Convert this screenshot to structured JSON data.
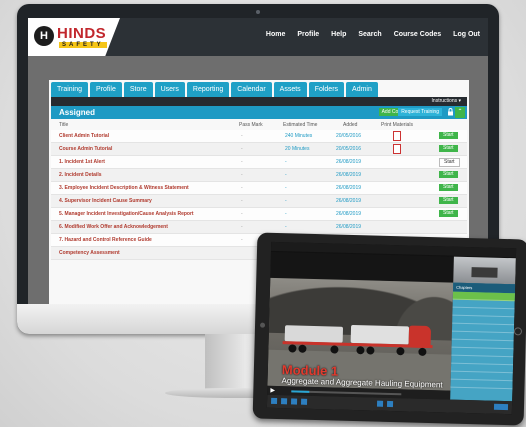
{
  "app": {
    "logo_main": "HINDS",
    "logo_sub": "SAFETY",
    "logo_mark": "H"
  },
  "topnav": [
    "Home",
    "Profile",
    "Help",
    "Search",
    "Course Codes",
    "Log Out"
  ],
  "tabs": [
    "Training",
    "Profile",
    "Store",
    "Users",
    "Reporting",
    "Calendar",
    "Assets",
    "Folders",
    "Admin"
  ],
  "toolbar": {
    "instructions": "Instructions ▾"
  },
  "assigned": {
    "title": "Assigned",
    "add_course": "Add Course",
    "request_training": "Request Training",
    "lock_icon": "lock-icon",
    "collapse_icon": "chevron-up-icon"
  },
  "columns": [
    "Title",
    "Pass Mark",
    "Estimated Time",
    "Added",
    "Print Materials"
  ],
  "rows": [
    {
      "title": "Client Admin Tutorial",
      "pass": "-",
      "est": "240 Minutes",
      "added": "20/05/2016",
      "pdf": true,
      "action": "Start",
      "style": "green"
    },
    {
      "title": "Course Admin Tutorial",
      "pass": "-",
      "est": "20 Minutes",
      "added": "20/05/2016",
      "pdf": true,
      "action": "Start",
      "style": "green"
    },
    {
      "title": "1. Incident 1st Alert",
      "pass": "-",
      "est": "-",
      "added": "26/08/2019",
      "pdf": false,
      "action": "Start",
      "style": "white"
    },
    {
      "title": "2. Incident Details",
      "pass": "-",
      "est": "-",
      "added": "26/08/2019",
      "pdf": false,
      "action": "Start",
      "style": "green"
    },
    {
      "title": "3. Employee Incident Description & Witness Statement",
      "pass": "-",
      "est": "-",
      "added": "26/08/2019",
      "pdf": false,
      "action": "Start",
      "style": "green"
    },
    {
      "title": "4. Supervisor Incident Cause Summary",
      "pass": "-",
      "est": "-",
      "added": "26/08/2019",
      "pdf": false,
      "action": "Start",
      "style": "green"
    },
    {
      "title": "5. Manager Incident Investigation/Cause Analysis Report",
      "pass": "-",
      "est": "-",
      "added": "26/08/2019",
      "pdf": false,
      "action": "Start",
      "style": "green"
    },
    {
      "title": "6. Modified Work Offer and Acknowledgement",
      "pass": "-",
      "est": "-",
      "added": "26/08/2019",
      "pdf": false,
      "action": "",
      "style": "none"
    },
    {
      "title": "7. Hazard and Control Reference Guide",
      "pass": "-",
      "est": "-",
      "added": "",
      "pdf": false,
      "action": "",
      "style": "none"
    },
    {
      "title": "Competency Assessment",
      "pass": "",
      "est": "",
      "added": "",
      "pdf": false,
      "action": "",
      "style": "none"
    }
  ],
  "tablet": {
    "module_title": "Module 1",
    "module_subtitle": "Aggregate and Aggregate Hauling Equipment",
    "chapters_label": "Chapters",
    "progress": 0.16,
    "accent": "#e23a2e"
  }
}
